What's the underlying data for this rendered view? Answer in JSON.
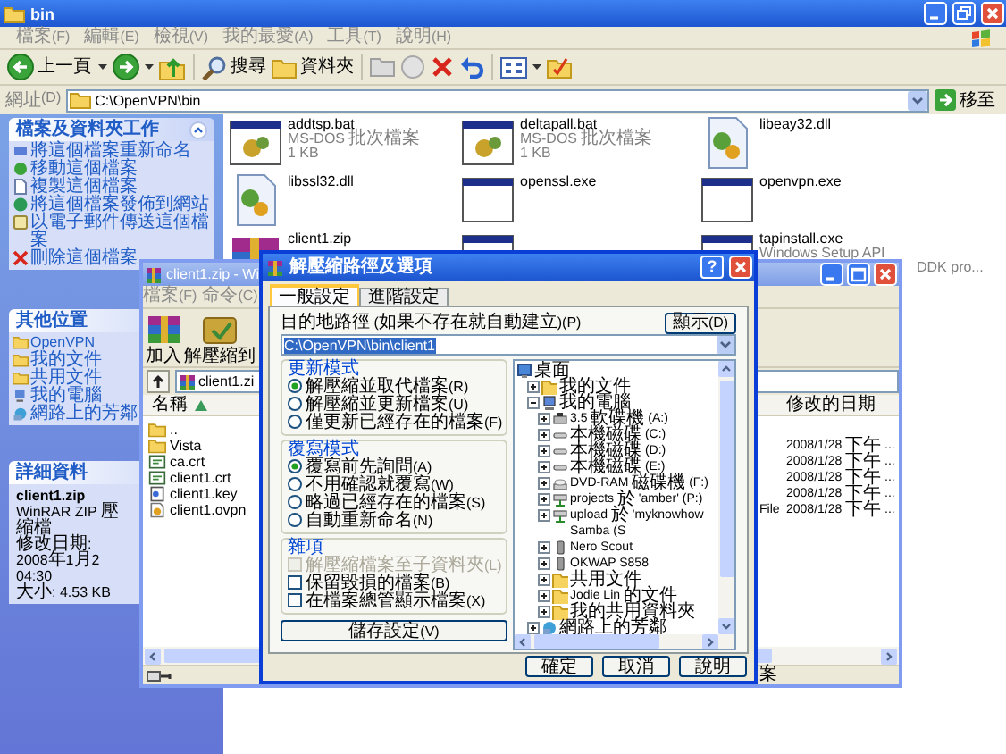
{
  "explorer": {
    "title": "bin",
    "menu": [
      "檔案(F)",
      "編輯(E)",
      "檢視(V)",
      "我的最愛(A)",
      "工具(T)",
      "說明(H)"
    ],
    "toolbar": {
      "back": "上一頁",
      "search": "搜尋",
      "folders": "資料夾"
    },
    "address": {
      "label": "網址(D)",
      "value": "C:\\OpenVPN\\bin",
      "go": "移至"
    },
    "task_panels": [
      {
        "kind": "tasks",
        "title": "檔案及資料夾工作",
        "collapsed": false,
        "items": [
          "將這個檔案重新命名",
          "移動這個檔案",
          "複製這個檔案",
          "將這個檔案發佈到網站",
          "以電子郵件傳送這個檔案",
          "刪除這個檔案"
        ]
      },
      {
        "kind": "places",
        "title": "其他位置",
        "items": [
          "OpenVPN",
          "我的文件",
          "共用文件",
          "我的電腦",
          "網路上的芳鄰"
        ]
      },
      {
        "kind": "details",
        "title": "詳細資料",
        "name": "client1.zip",
        "lines": [
          "WinRAR ZIP 壓縮檔",
          "修改日期: 2008年1月2",
          "04:30",
          "大小: 4.53 KB"
        ]
      }
    ],
    "files": [
      {
        "name": "addtsp.bat",
        "kind": "batch",
        "lines": [
          "MS-DOS 批次檔案",
          "1 KB"
        ]
      },
      {
        "name": "deltapall.bat",
        "kind": "batch",
        "lines": [
          "MS-DOS 批次檔案",
          "1 KB"
        ]
      },
      {
        "name": "libeay32.dll",
        "kind": "dll"
      },
      {
        "name": "libssl32.dll",
        "kind": "dll"
      },
      {
        "name": "openssl.exe",
        "kind": "exe"
      },
      {
        "name": "openvpn.exe",
        "kind": "exe"
      },
      {
        "name": "client1.zip",
        "kind": "archive"
      },
      {
        "kind": "exe"
      },
      {
        "name": "tapinstall.exe",
        "kind": "exe",
        "lines": [
          "Windows Setup API",
          "DDK pro..."
        ]
      }
    ]
  },
  "winrar": {
    "title": "client1.zip - Wi",
    "menu": [
      "檔案(F)",
      "命令(C)"
    ],
    "toolbar": [
      "加入",
      "解壓縮到"
    ],
    "path": "client1.zi",
    "columns": {
      "name": "名稱",
      "modified": "修改的日期"
    },
    "rows": [
      {
        "name": "..",
        "kind": "up"
      },
      {
        "name": "Vista",
        "kind": "folder",
        "modified": "2008/1/28 下午 ..."
      },
      {
        "name": "ca.crt",
        "kind": "cert",
        "modified": "2008/1/28 下午 ..."
      },
      {
        "name": "client1.crt",
        "kind": "cert",
        "modified": "2008/1/28 下午 ..."
      },
      {
        "name": "client1.key",
        "kind": "key",
        "modified": "2008/1/28 下午 ..."
      },
      {
        "name": "client1.ovpn",
        "kind": "config",
        "type": "File",
        "modified": "2008/1/28 下午 ..."
      }
    ],
    "status": "案"
  },
  "dialog": {
    "title": "解壓縮路徑及選項",
    "help": "?",
    "tabs": [
      {
        "label": "一般設定",
        "selected": true
      },
      {
        "label": "進階設定",
        "selected": false
      }
    ],
    "dest_label": "目的地路徑 (如果不存在就自動建立)(P)",
    "show_button": "顯示(D)",
    "dest_path": {
      "value": "C:\\OpenVPN\\bin\\client1",
      "selected": true
    },
    "groups": [
      {
        "title": "更新模式",
        "options": [
          {
            "kind": "radio",
            "label": "解壓縮並取代檔案(R)",
            "selected": true
          },
          {
            "kind": "radio",
            "label": "解壓縮並更新檔案(U)",
            "selected": false
          },
          {
            "kind": "radio",
            "label": "僅更新已經存在的檔案(F)",
            "selected": false
          }
        ]
      },
      {
        "title": "覆寫模式",
        "options": [
          {
            "kind": "radio",
            "label": "覆寫前先詢問(A)",
            "selected": true
          },
          {
            "kind": "radio",
            "label": "不用確認就覆寫(W)",
            "selected": false
          },
          {
            "kind": "radio",
            "label": "略過已經存在的檔案(S)",
            "selected": false
          },
          {
            "kind": "radio",
            "label": "自動重新命名(N)",
            "selected": false
          }
        ]
      },
      {
        "title": "雜項",
        "options": [
          {
            "kind": "checkbox",
            "label": "解壓縮檔案至子資料夾(L)",
            "checked": false,
            "disabled": true
          },
          {
            "kind": "checkbox",
            "label": "保留毀損的檔案(B)",
            "checked": false,
            "disabled": false
          },
          {
            "kind": "checkbox",
            "label": "在檔案總管顯示檔案(X)",
            "checked": false,
            "disabled": false
          }
        ]
      }
    ],
    "save_button": "儲存設定(V)",
    "tree": [
      {
        "label": "桌面",
        "kind": "desktop",
        "expanded": true,
        "children": [
          {
            "label": "我的文件",
            "kind": "folder",
            "expanded": false
          },
          {
            "label": "我的電腦",
            "kind": "computer",
            "expanded": true,
            "children": [
              {
                "label": "3.5 軟碟機 (A:)",
                "kind": "floppy",
                "expanded": false
              },
              {
                "label": "本機磁碟 (C:)",
                "kind": "drive",
                "expanded": false
              },
              {
                "label": "本機磁碟 (D:)",
                "kind": "drive",
                "expanded": false
              },
              {
                "label": "本機磁碟 (E:)",
                "kind": "drive",
                "expanded": false
              },
              {
                "label": "DVD-RAM 磁碟機 (F:)",
                "kind": "dvd",
                "expanded": false
              },
              {
                "label": "projects 於 'amber' (P:)",
                "kind": "netdrive",
                "expanded": false
              },
              {
                "label": "upload 於 'myknowhow Samba (S",
                "kind": "netdrive",
                "expanded": false
              },
              {
                "label": "Nero Scout",
                "kind": "device",
                "expanded": false
              },
              {
                "label": "OKWAP S858",
                "kind": "device",
                "expanded": false
              },
              {
                "label": "共用文件",
                "kind": "folder",
                "expanded": false
              },
              {
                "label": "Jodie Lin 的文件",
                "kind": "folder",
                "expanded": false
              },
              {
                "label": "我的共用資料夾",
                "kind": "folder",
                "expanded": false
              }
            ]
          },
          {
            "label": "網路上的芳鄰",
            "kind": "network",
            "expanded": false
          }
        ]
      }
    ],
    "buttons": [
      "確定",
      "取消",
      "說明"
    ]
  }
}
